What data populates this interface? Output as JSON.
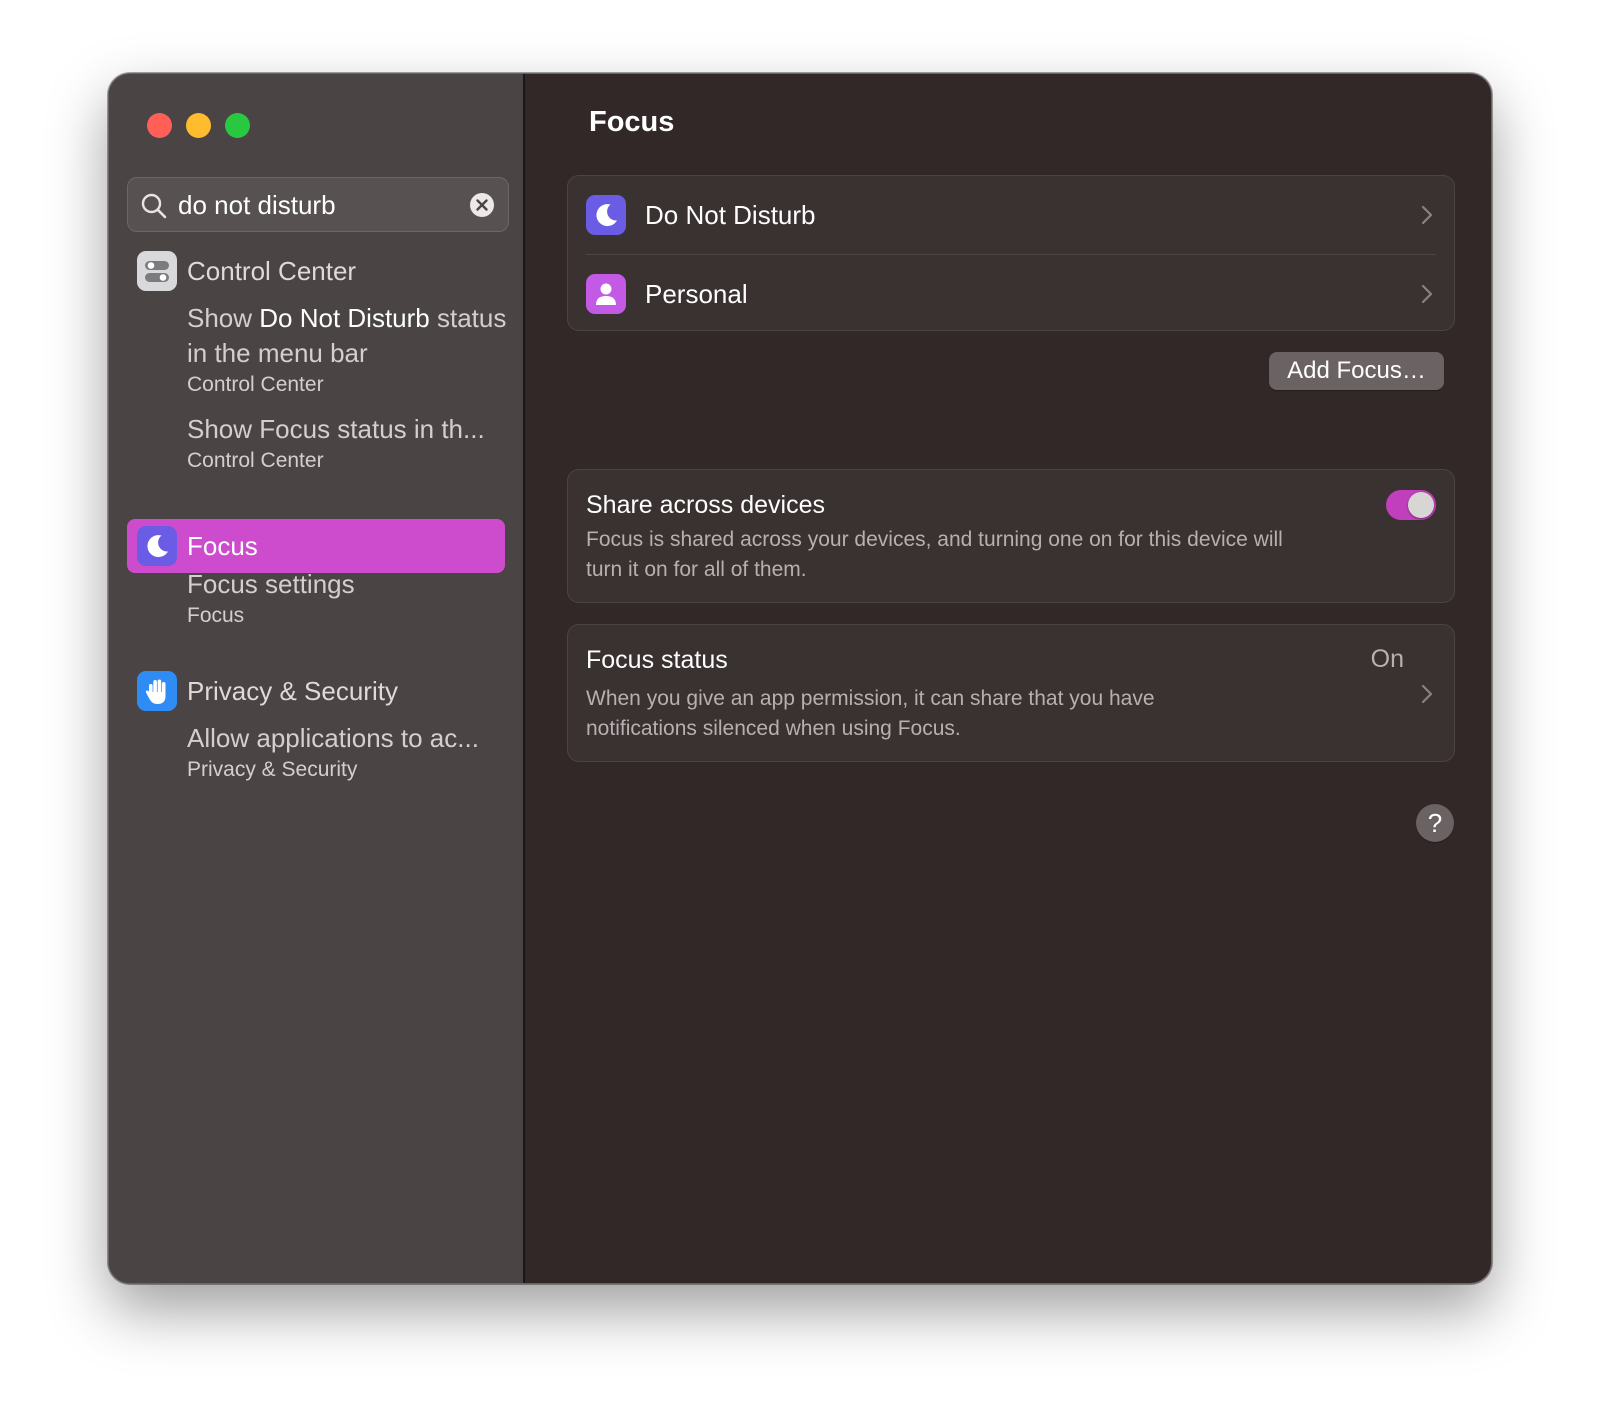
{
  "window": {
    "traffic_lights": {
      "close_color": "#ff5f57",
      "minimize_color": "#febc2e",
      "maximize_color": "#28c840"
    }
  },
  "sidebar": {
    "search": {
      "value": "do not disturb",
      "icon": "magnifying-glass",
      "clear_icon": "xmark-circle"
    },
    "categories": [
      {
        "label": "Control Center",
        "icon": "control-center-toggles",
        "results": [
          {
            "title_prefix": "Show ",
            "title_highlight": "Do Not Disturb",
            "title_suffix": " status in the menu bar",
            "subtitle": "Control Center"
          },
          {
            "title": "Show Focus status in th...",
            "subtitle": "Control Center"
          }
        ]
      },
      {
        "label": "Focus",
        "icon": "moon",
        "selected": true,
        "results": [
          {
            "title": "Focus settings",
            "subtitle": "Focus"
          }
        ]
      },
      {
        "label": "Privacy & Security",
        "icon": "raised-hand",
        "results": [
          {
            "title": "Allow applications to ac...",
            "subtitle": "Privacy & Security"
          }
        ]
      }
    ],
    "selection_color": "#cd4ccd"
  },
  "main": {
    "title": "Focus",
    "focus_modes": [
      {
        "label": "Do Not Disturb",
        "icon": "moon",
        "icon_color": "#6b5ce6"
      },
      {
        "label": "Personal",
        "icon": "person",
        "icon_color": "#c25ae6"
      }
    ],
    "add_focus_label": "Add Focus…",
    "share_across_devices": {
      "title": "Share across devices",
      "description_line1": "Focus is shared across your devices, and turning one on for this device will",
      "description_line2": "turn it on for all of them.",
      "enabled": true,
      "toggle_color": "#c13fbc"
    },
    "focus_status": {
      "title": "Focus status",
      "value": "On",
      "description_line1": "When you give an app permission, it can share that you have",
      "description_line2": "notifications silenced when using Focus."
    },
    "help_label": "?"
  }
}
